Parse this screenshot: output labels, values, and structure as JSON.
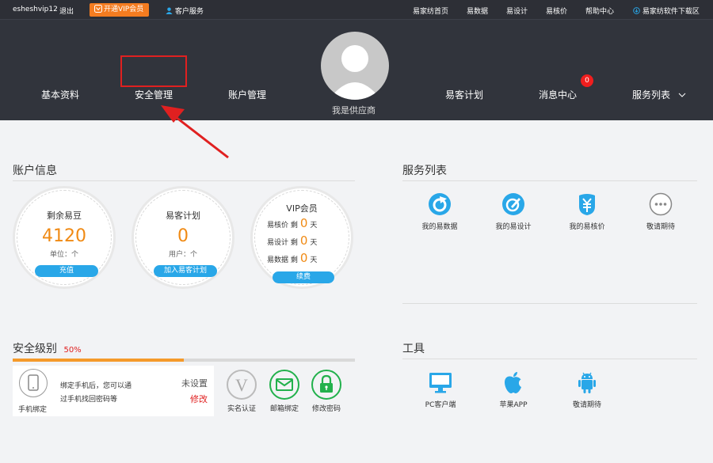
{
  "topbar": {
    "username": "esheshvip12",
    "logout": "退出",
    "vip_button": "开通VIP会员",
    "customer_service": "客户服务",
    "links": [
      "易家纺首页",
      "易数据",
      "易设计",
      "易核价",
      "帮助中心"
    ],
    "download": "易家纺软件下载区"
  },
  "nav": {
    "items": [
      "基本资料",
      "安全管理",
      "账户管理",
      "易客计划",
      "消息中心",
      "服务列表"
    ],
    "message_badge": "0",
    "supplier_label": "我是供应商"
  },
  "account": {
    "title": "账户信息",
    "beans": {
      "title": "剩余易豆",
      "value": "4120",
      "unit": "单位：个",
      "button": "充值"
    },
    "plan": {
      "title": "易客计划",
      "value": "0",
      "unit": "用户：个",
      "button": "加入易客计划"
    },
    "vip": {
      "title": "VIP会员",
      "rows": [
        {
          "label": "易核价 剩",
          "value": "0",
          "suffix": "天"
        },
        {
          "label": "易设计 剩",
          "value": "0",
          "suffix": "天"
        },
        {
          "label": "易数据 剩",
          "value": "0",
          "suffix": "天"
        }
      ],
      "button": "续费"
    }
  },
  "services": {
    "title": "服务列表",
    "items": [
      {
        "label": "我的易数据",
        "icon": "data-icon",
        "color": "#29a7e8"
      },
      {
        "label": "我的易设计",
        "icon": "design-icon",
        "color": "#29a7e8"
      },
      {
        "label": "我的易核价",
        "icon": "price-icon",
        "color": "#29a7e8"
      },
      {
        "label": "敬请期待",
        "icon": "more-icon",
        "color": "#888888"
      }
    ]
  },
  "security": {
    "title": "安全级别",
    "percent": "50%",
    "progress": 0.5,
    "phone_label": "手机绑定",
    "phone_desc_1": "绑定手机后，您可以通",
    "phone_desc_2": "过手机找回密码等",
    "status": "未设置",
    "modify": "修改",
    "items": [
      {
        "label": "实名认证",
        "icon": "verify-icon",
        "color": "#bbbbbb"
      },
      {
        "label": "邮箱绑定",
        "icon": "mail-icon",
        "color": "#22b14c"
      },
      {
        "label": "修改密码",
        "icon": "lock-icon",
        "color": "#22b14c"
      }
    ]
  },
  "tools": {
    "title": "工具",
    "items": [
      {
        "label": "PC客户端",
        "icon": "monitor-icon",
        "color": "#29a7e8"
      },
      {
        "label": "苹果APP",
        "icon": "apple-icon",
        "color": "#29a7e8"
      },
      {
        "label": "敬请期待",
        "icon": "android-icon",
        "color": "#29a7e8"
      }
    ]
  },
  "colors": {
    "accent": "#f08a14",
    "blue": "#29a7e8",
    "header": "#31343c",
    "highlight": "#e02020"
  }
}
